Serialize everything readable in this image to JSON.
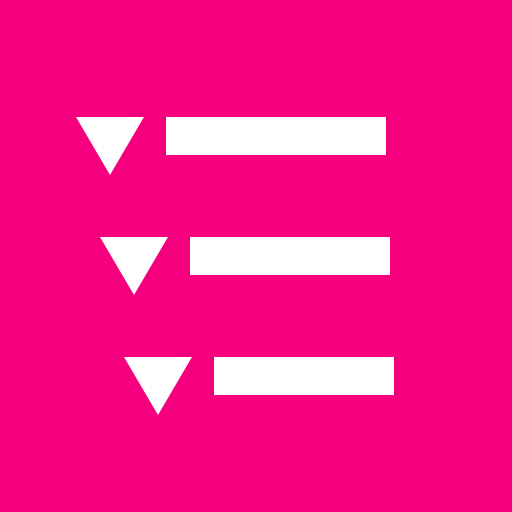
{
  "icon": {
    "name": "nested-list-icon",
    "background_color": "#F5007F",
    "foreground_color": "#FFFFFF",
    "items": [
      {
        "name": "list-row-1"
      },
      {
        "name": "list-row-2"
      },
      {
        "name": "list-row-3"
      }
    ]
  }
}
